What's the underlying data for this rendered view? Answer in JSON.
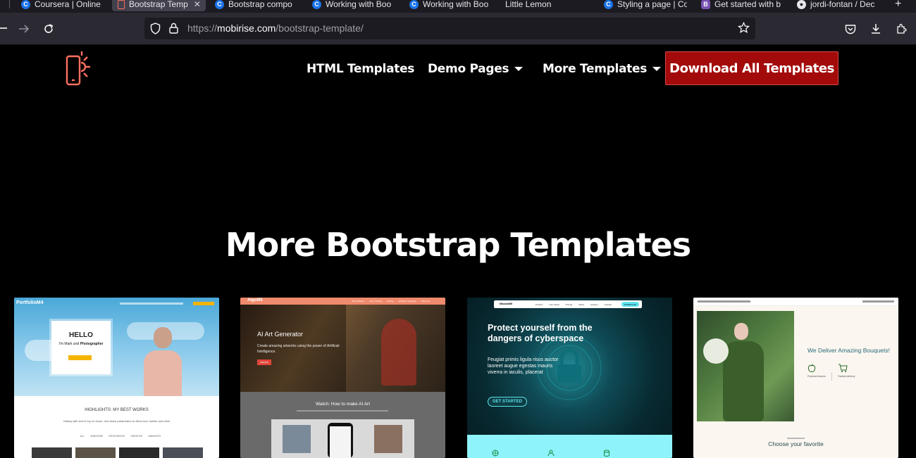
{
  "browser": {
    "tabs": [
      {
        "title": "Coursera | Online",
        "icon": "coursera-icon"
      },
      {
        "title": "Bootstrap Temp",
        "icon": "mobirise-icon",
        "active": true
      },
      {
        "title": "Bootstrap compo",
        "icon": "coursera-icon"
      },
      {
        "title": "Working with Boo",
        "icon": "coursera-icon"
      },
      {
        "title": "Working with Boo",
        "icon": "coursera-icon"
      },
      {
        "title": "Little Lemon",
        "icon": ""
      },
      {
        "title": "Styling a page | Co",
        "icon": "coursera-icon"
      },
      {
        "title": "Get started with b",
        "icon": "bootstrap-icon"
      },
      {
        "title": "jordi-fontan / Dec",
        "icon": "github-icon"
      }
    ],
    "new_tab_label": "+",
    "close_tab_label": "✕",
    "url_prefix": "https://",
    "url_host": "mobirise.com",
    "url_path": "/bootstrap-template/"
  },
  "site": {
    "menu": {
      "html_templates": "HTML Templates",
      "demo_pages": "Demo Pages",
      "more_templates": "More Templates"
    },
    "cta": "Download All Templates",
    "headline": "More Bootstrap Templates",
    "brand_color": "#ff6f61",
    "cta_color": "#a30a0a"
  },
  "cards": {
    "portfolio": {
      "brand": "PortfolioM4",
      "hello": "HELLO",
      "intro_1": "I'm Mark and ",
      "intro_bold": "Photographer",
      "highlights_prefix": "HIGHLIGHTS: ",
      "highlights_suffix": "MY BEST WORKS",
      "gallery_text": "Gallery with text in top on hover. Use block parameters to off/on text, bullets and other",
      "filters": [
        "ALL",
        "AWESOME",
        "RESPONSIVE",
        "CREATIVE",
        "ANIMATED"
      ]
    },
    "algo": {
      "brand": "AlgoM5",
      "nav": [
        "Why Mobirise",
        "How It Works",
        "Pricing",
        "Software Upgrades",
        "About Us"
      ],
      "title": "AI Art Generator",
      "desc": "Create amazing artworks using the power of Artificial Intelligence.",
      "button": "CREATE",
      "watch": "Watch: How to make AI Art"
    },
    "mission": {
      "brand": "MissionM5",
      "nav": [
        "Product",
        "Use Cases",
        "Pricing",
        "About",
        "Careers",
        "Contact"
      ],
      "nav_button": "DOWNLOAD",
      "title": "Protect yourself from the dangers of cyberspace",
      "desc": "Feugiat primis ligula risus auctor laoreet augue egestas mauris viverra in iaculis, placerat",
      "button": "GET STARTED"
    },
    "flower": {
      "title": "We Deliver Amazing Bouquets!",
      "feature_1": "Freshest flowers",
      "feature_2": "Fastest delivery",
      "choose": "Choose your favorite"
    }
  }
}
